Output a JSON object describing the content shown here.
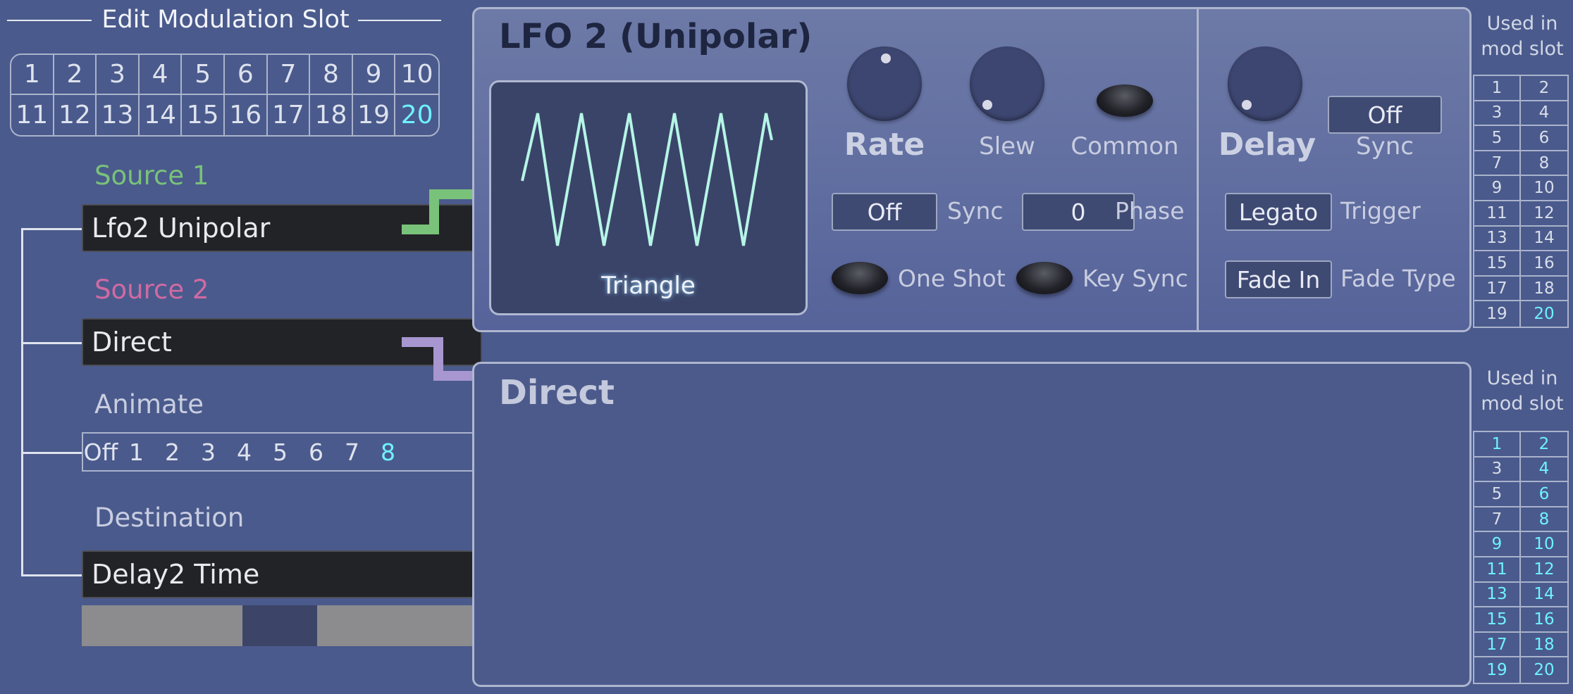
{
  "edit_title": "Edit Modulation Slot",
  "slots": [
    "1",
    "2",
    "3",
    "4",
    "5",
    "6",
    "7",
    "8",
    "9",
    "10",
    "11",
    "12",
    "13",
    "14",
    "15",
    "16",
    "17",
    "18",
    "19",
    "20"
  ],
  "active_slot": "20",
  "source1": {
    "label": "Source 1",
    "value": "Lfo2 Unipolar"
  },
  "source2": {
    "label": "Source 2",
    "value": "Direct"
  },
  "animate": {
    "label": "Animate",
    "options": [
      "Off",
      "1",
      "2",
      "3",
      "4",
      "5",
      "6",
      "7",
      "8"
    ],
    "selected": "8"
  },
  "destination": {
    "label": "Destination",
    "value": "Delay2 Time"
  },
  "lfo_panel": {
    "title": "LFO 2 (Unipolar)",
    "waveform": "Triangle",
    "rate_label": "Rate",
    "slew_label": "Slew",
    "common_label": "Common",
    "sync_value": "Off",
    "sync_label": "Sync",
    "phase_value": "0",
    "phase_label": "Phase",
    "oneshot_label": "One Shot",
    "keysync_label": "Key Sync",
    "delay_label": "Delay",
    "delay_sync_value": "Off",
    "delay_sync_label": "Sync",
    "trigger_value": "Legato",
    "trigger_label": "Trigger",
    "fade_value": "Fade In",
    "fade_label": "Fade Type"
  },
  "direct_panel": {
    "title": "Direct"
  },
  "used_in": {
    "heading": "Used in mod slot",
    "lfo_active": [
      "20"
    ],
    "direct_active": [
      "1",
      "2",
      "4",
      "6",
      "8",
      "9",
      "10",
      "11",
      "12",
      "13",
      "14",
      "15",
      "16",
      "17",
      "18",
      "19",
      "20"
    ]
  },
  "colors": {
    "accent": "#6ff2ff",
    "source1": "#79c27a",
    "source2": "#d06aa3",
    "background": "#4a5a8c"
  }
}
